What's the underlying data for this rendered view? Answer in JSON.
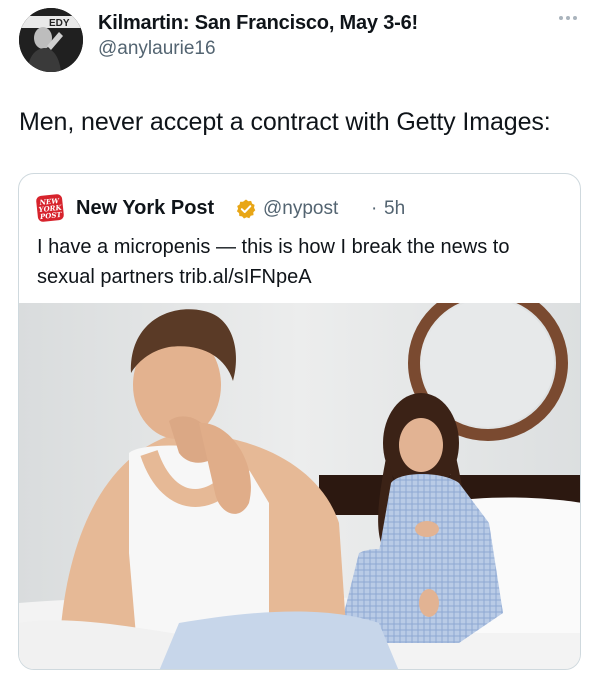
{
  "author": {
    "name": "Kilmartin: San Francisco, May 3-6!",
    "handle": "@anylaurie16",
    "avatar_text": "EDY"
  },
  "tweet": {
    "text": "Men, never accept a contract with Getty Images:"
  },
  "icons": {
    "more": "more-horizontal-icon",
    "verified": "verified-badge-icon",
    "source_logo": "new-york-post-logo"
  },
  "quoted": {
    "logo_lines": [
      "NEW",
      "YORK",
      "POST"
    ],
    "name": "New York Post",
    "handle": "@nypost",
    "separator": "·",
    "time": "5h",
    "text": "I have a micropenis — this is how I break the news to sexual partners trib.al/sIFNpeA"
  },
  "colors": {
    "text_primary": "#0f1419",
    "text_secondary": "#536471",
    "border": "#cfd9de",
    "verified_gold": "#e8a616",
    "nypost_red": "#d7232c"
  }
}
